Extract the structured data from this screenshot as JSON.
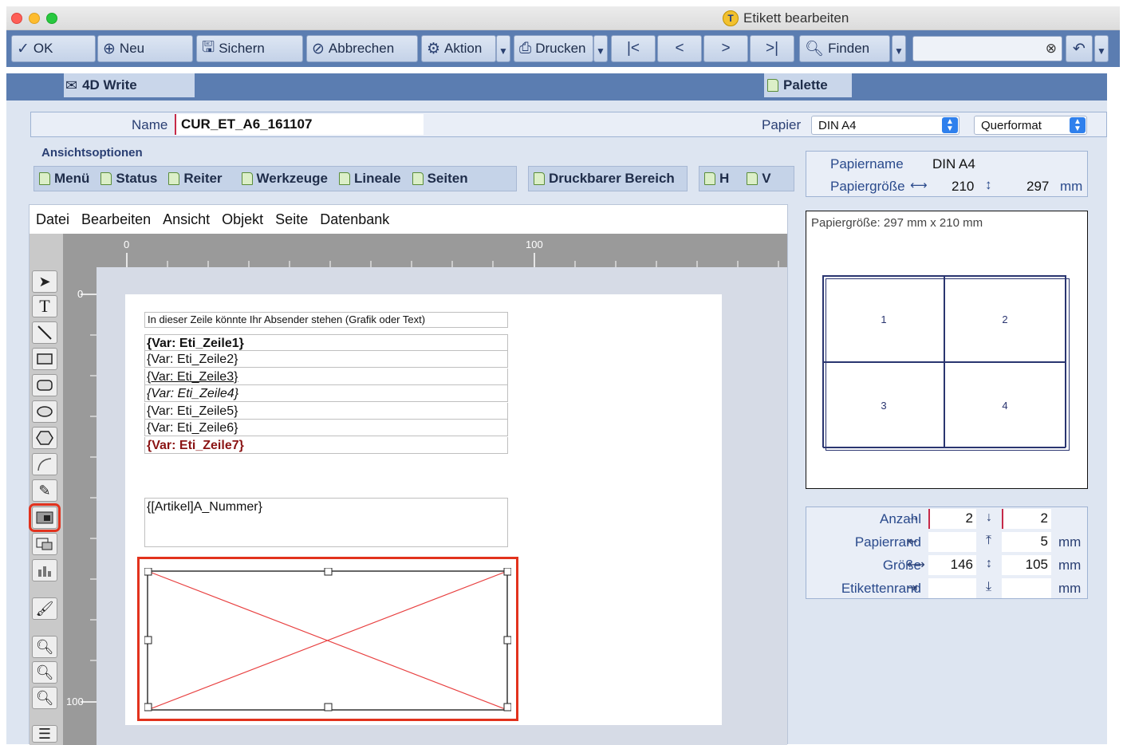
{
  "window": {
    "title": "Etikett bearbeiten",
    "logo_letter": "T"
  },
  "toolbar": {
    "ok": "OK",
    "neu": "Neu",
    "sichern": "Sichern",
    "abbrechen": "Abbrechen",
    "aktion": "Aktion",
    "drucken": "Drucken",
    "finden": "Finden",
    "search_value": ""
  },
  "tabs": {
    "left": "4D Write",
    "right": "Palette"
  },
  "form": {
    "name_label": "Name",
    "name_value": "CUR_ET_A6_161107",
    "papier_label": "Papier",
    "papier_value": "DIN A4",
    "orientation_value": "Querformat"
  },
  "view_options": {
    "heading": "Ansichtsoptionen",
    "group1": [
      "Menü",
      "Status",
      "Reiter",
      "Werkzeuge",
      "Lineale",
      "Seiten"
    ],
    "group2": [
      "Druckbarer Bereich"
    ],
    "group3": [
      "H",
      "V"
    ]
  },
  "editor": {
    "menu": [
      "Datei",
      "Bearbeiten",
      "Ansicht",
      "Objekt",
      "Seite",
      "Datenbank"
    ],
    "ruler_h": [
      "0",
      "100"
    ],
    "ruler_v": [
      "0",
      "100"
    ],
    "sender_line": "In dieser Zeile könnte Ihr Absender stehen (Grafik oder Text)",
    "var_lines": [
      "{Var: Eti_Zeile1}",
      "{Var: Eti_Zeile2}",
      "{Var: Eti_Zeile3}",
      "{Var: Eti_Zeile4}",
      "{Var: Eti_Zeile5}",
      "{Var: Eti_Zeile6}",
      "{Var: Eti_Zeile7}"
    ],
    "artikel_field": "{[Artikel]A_Nummer}"
  },
  "paper_info": {
    "name_label": "Papiername",
    "name_value": "DIN A4",
    "size_label": "Papiergröße",
    "width": "210",
    "height": "297",
    "unit": "mm"
  },
  "preview": {
    "caption": "Papiergröße: 297 mm  x 210 mm",
    "cells": [
      "1",
      "2",
      "3",
      "4"
    ]
  },
  "params": {
    "anzahl_label": "Anzahl",
    "anzahl_h": "2",
    "anzahl_v": "2",
    "papierrand_label": "Papierrand",
    "papierrand_left": "",
    "papierrand_top": "5",
    "groesse_label": "Größe",
    "groesse_w": "146",
    "groesse_h": "105",
    "etikettenrand_label": "Etikettenrand",
    "etikettenrand_h": "",
    "etikettenrand_v": "",
    "unit": "mm"
  },
  "colors": {
    "toolbar": "#5b7db1",
    "accent_red": "#e2321d",
    "label_blue": "#2a4a8c"
  }
}
